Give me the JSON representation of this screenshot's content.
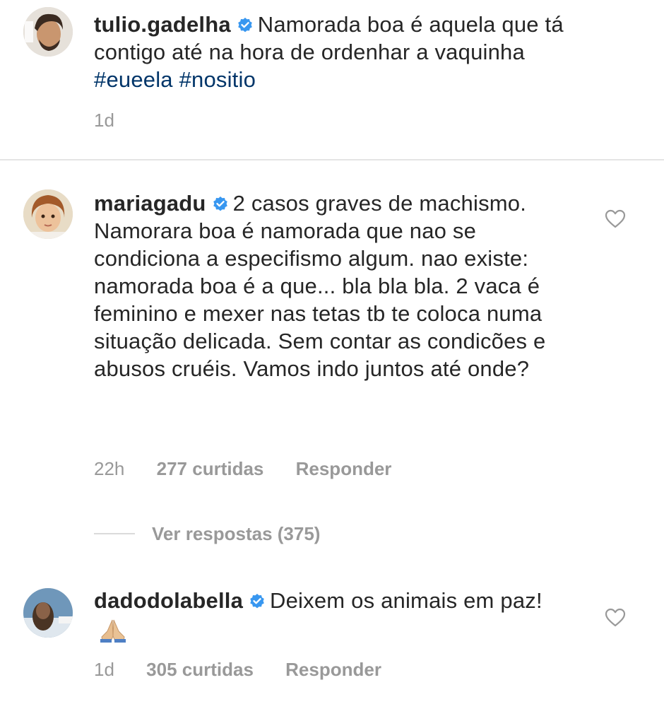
{
  "comments": [
    {
      "username": "tulio.gadelha",
      "text_before": "Namorada boa é aquela que tá contigo até na hora de ordenhar a vaquinha",
      "hashtags": [
        "#eueela",
        "#nositio"
      ],
      "time": "1d"
    },
    {
      "username": "mariagadu",
      "text": "2 casos graves de machismo. Namorara boa é namorada que nao se condiciona a especifismo algum. nao existe: namorada boa é a que... bla bla bla. 2 vaca é feminino e mexer nas tetas tb te coloca numa situação delicada. Sem contar as condicões e abusos cruéis. Vamos indo juntos até onde?",
      "time": "22h",
      "likes": "277 curtidas",
      "reply": "Responder",
      "view_replies": "Ver respostas (375)"
    },
    {
      "username": "dadodolabella",
      "text": "Deixem os animais em paz!",
      "emoji": "folded-hands",
      "time": "1d",
      "likes": "305 curtidas",
      "reply": "Responder"
    }
  ],
  "colors": {
    "text": "#262626",
    "muted": "#999999",
    "hashtag": "#003569",
    "verified": "#3897f0",
    "divider": "#e4e4e4"
  },
  "icons": {
    "verified": "verified-badge-icon",
    "like": "heart-icon"
  }
}
